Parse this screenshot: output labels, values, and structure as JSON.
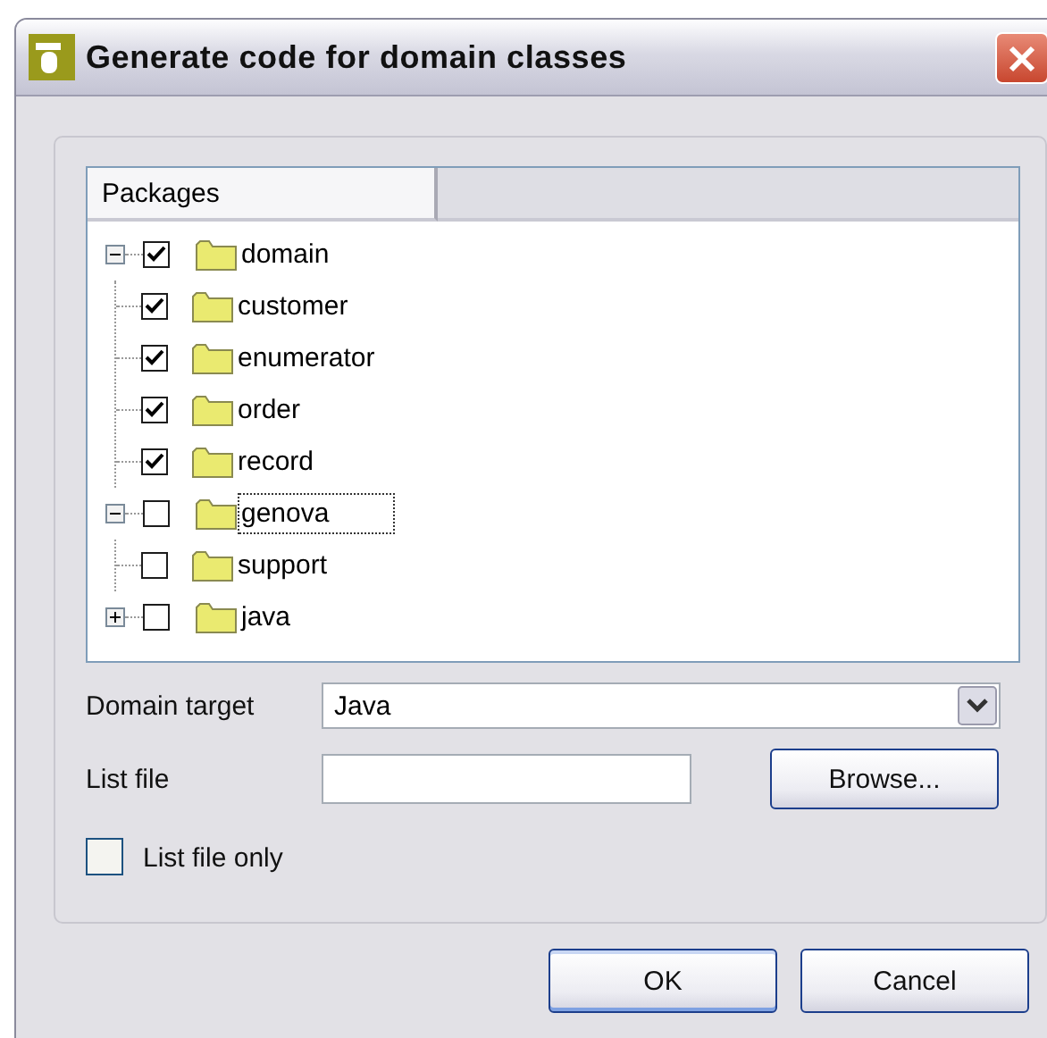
{
  "window": {
    "title": "Generate code for domain classes"
  },
  "tree": {
    "columns": [
      "Packages"
    ],
    "items": [
      {
        "label": "domain",
        "checked": true,
        "expanded": true,
        "selected": false,
        "children": [
          {
            "label": "customer",
            "checked": true,
            "selected": false
          },
          {
            "label": "enumerator",
            "checked": true,
            "selected": false
          },
          {
            "label": "order",
            "checked": true,
            "selected": false
          },
          {
            "label": "record",
            "checked": true,
            "selected": false
          }
        ]
      },
      {
        "label": "genova",
        "checked": false,
        "expanded": true,
        "selected": true,
        "children": [
          {
            "label": "support",
            "checked": false,
            "selected": false
          }
        ]
      },
      {
        "label": "java",
        "checked": false,
        "expanded": false,
        "selected": false
      }
    ]
  },
  "domain_target": {
    "label": "Domain target",
    "value": "Java"
  },
  "list_file": {
    "label": "List file",
    "button": "Browse..."
  },
  "list_file_only": {
    "label": "List file only",
    "checked": false
  },
  "buttons": [
    "OK",
    "Cancel"
  ]
}
